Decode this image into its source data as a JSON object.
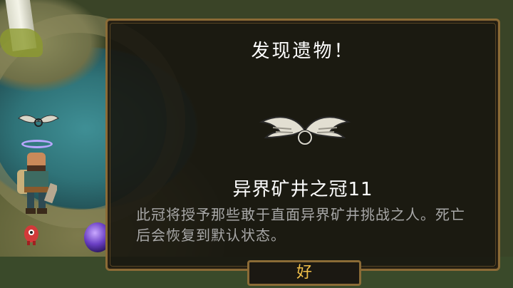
{
  "relic_dialog": {
    "title": "发现遗物！",
    "relic_name": "异界矿井之冠11",
    "relic_description": "此冠将授予那些敢于直面异界矿井挑战之人。死亡后会恢复到默认状态。",
    "ok_button_label": "好",
    "relic_icon": "winged-halo-icon"
  },
  "colors": {
    "dialog_border": "#8b6b36",
    "title_text": "#ffffff",
    "description_text": "#a8a8a8",
    "button_text": "#f2c04a"
  }
}
